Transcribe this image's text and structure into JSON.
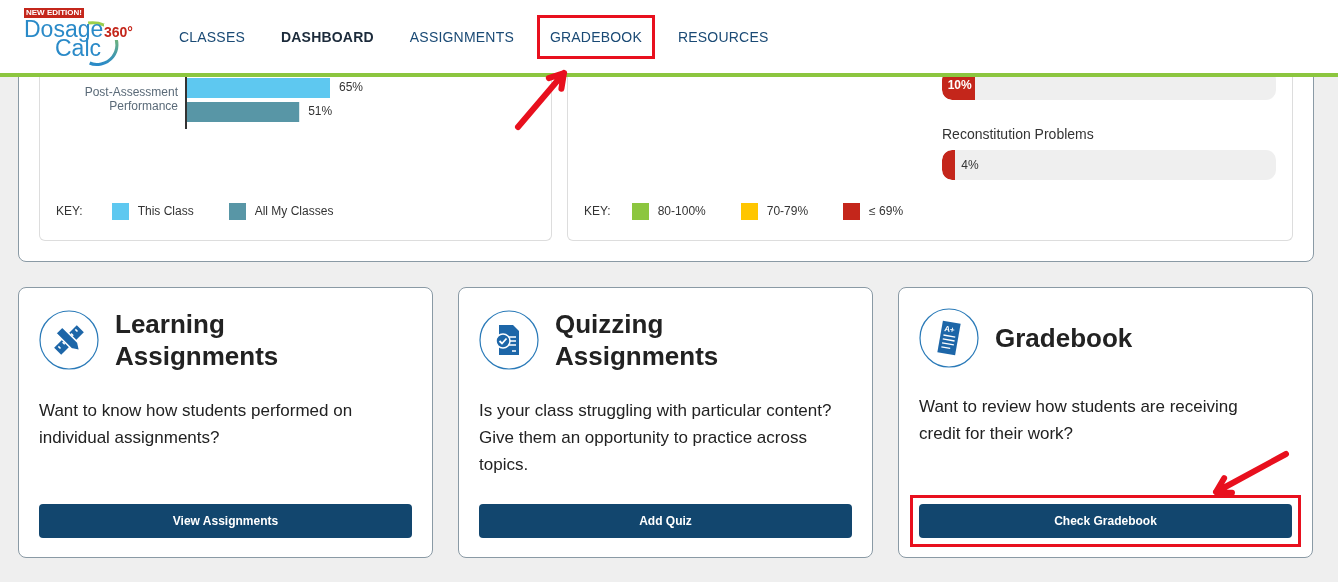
{
  "header": {
    "logo": {
      "badge": "NEW EDITION!",
      "line1": "Dosage",
      "line2": "Calc",
      "mark": "360°"
    },
    "nav": [
      {
        "label": "CLASSES",
        "selected": false,
        "highlighted": false
      },
      {
        "label": "DASHBOARD",
        "selected": true,
        "highlighted": false
      },
      {
        "label": "ASSIGNMENTS",
        "selected": false,
        "highlighted": false
      },
      {
        "label": "GRADEBOOK",
        "selected": false,
        "highlighted": true
      },
      {
        "label": "RESOURCES",
        "selected": false,
        "highlighted": false
      }
    ]
  },
  "performance_card": {
    "chart_data": {
      "type": "bar",
      "orientation": "horizontal",
      "categories": [
        "Post-Assessment Performance"
      ],
      "series": [
        {
          "name": "This Class",
          "color": "#5ec8f0",
          "values": [
            65
          ],
          "value_labels": [
            "65%"
          ]
        },
        {
          "name": "All My Classes",
          "color": "#5896a6",
          "values": [
            51
          ],
          "value_labels": [
            "51%"
          ]
        }
      ]
    },
    "key_label": "KEY:"
  },
  "topics_card": {
    "topics": [
      {
        "level": 0.1,
        "reading": "10%",
        "color": "#c4261b"
      },
      {
        "label": "Reconstitution Problems",
        "level": 0.04,
        "reading": "4%",
        "color": "#c4261b"
      }
    ],
    "key_label": "KEY:",
    "key": [
      {
        "label": "80-100%",
        "color": "#8cc63f"
      },
      {
        "label": "70-79%",
        "color": "#ffc600"
      },
      {
        "label": "≤ 69%",
        "color": "#c4261b"
      }
    ]
  },
  "cards": [
    {
      "kind": "learning",
      "title": "Learning Assignments",
      "text": "Want to know how students performed on individual assignments?",
      "button": "View Assignments",
      "highlighted": false
    },
    {
      "kind": "quizzing",
      "title": "Quizzing Assignments",
      "text": "Is your class struggling with particular content? Give them an opportunity to practice across topics.",
      "button": "Add Quiz",
      "highlighted": false
    },
    {
      "kind": "gradebook",
      "icon_label": "A+",
      "title": "Gradebook",
      "text": "Want to review how students are receiving credit for their work?",
      "button": "Check Gradebook",
      "highlighted": true
    }
  ]
}
